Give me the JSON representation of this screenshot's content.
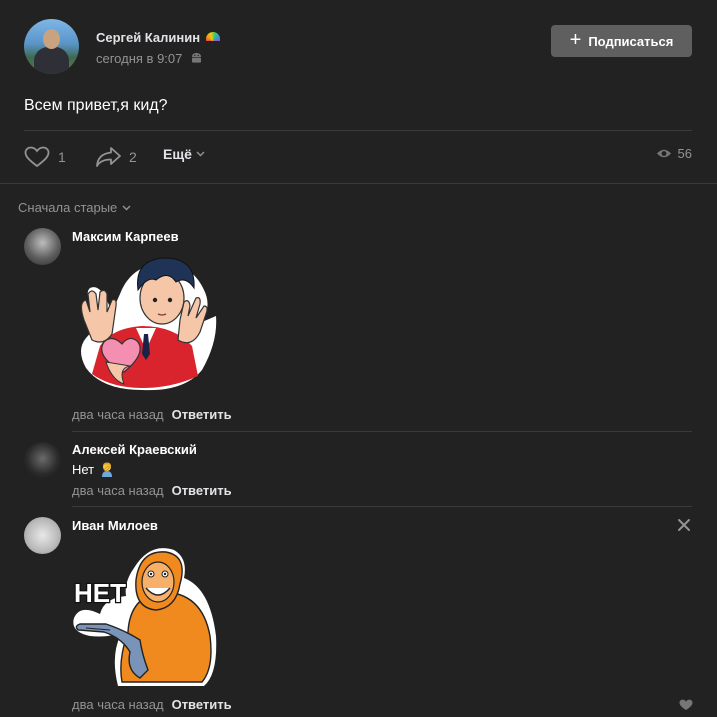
{
  "post": {
    "author_name": "Сергей Калинин",
    "author_badge_icon": "rainbow-icon",
    "timestamp": "сегодня в 9:07",
    "platform_icon": "android-icon",
    "subscribe_label": "Подписаться",
    "text": "Всем привет,я кид?",
    "likes": "1",
    "shares": "2",
    "more_label": "Ещё",
    "views": "56"
  },
  "comments_header": {
    "sort_label": "Сначала старые"
  },
  "comments": [
    {
      "author": "Максим Карпеев",
      "attachment": "sticker-man-with-heart",
      "time": "два часа назад",
      "reply_label": "Ответить"
    },
    {
      "author": "Алексей Краевский",
      "text": "Нет",
      "text_emoji": "person-facepalming-emoji",
      "time": "два часа назад",
      "reply_label": "Ответить"
    },
    {
      "author": "Иван Милоев",
      "attachment": "sticker-monkey-net",
      "sticker_text": "НЕТ",
      "time": "два часа назад",
      "reply_label": "Ответить"
    }
  ],
  "colors": {
    "background": "#222222",
    "text_primary": "#e1e3e6",
    "text_secondary": "#939393",
    "button_bg": "#5f5f5f",
    "divider": "#3a3a3a"
  }
}
